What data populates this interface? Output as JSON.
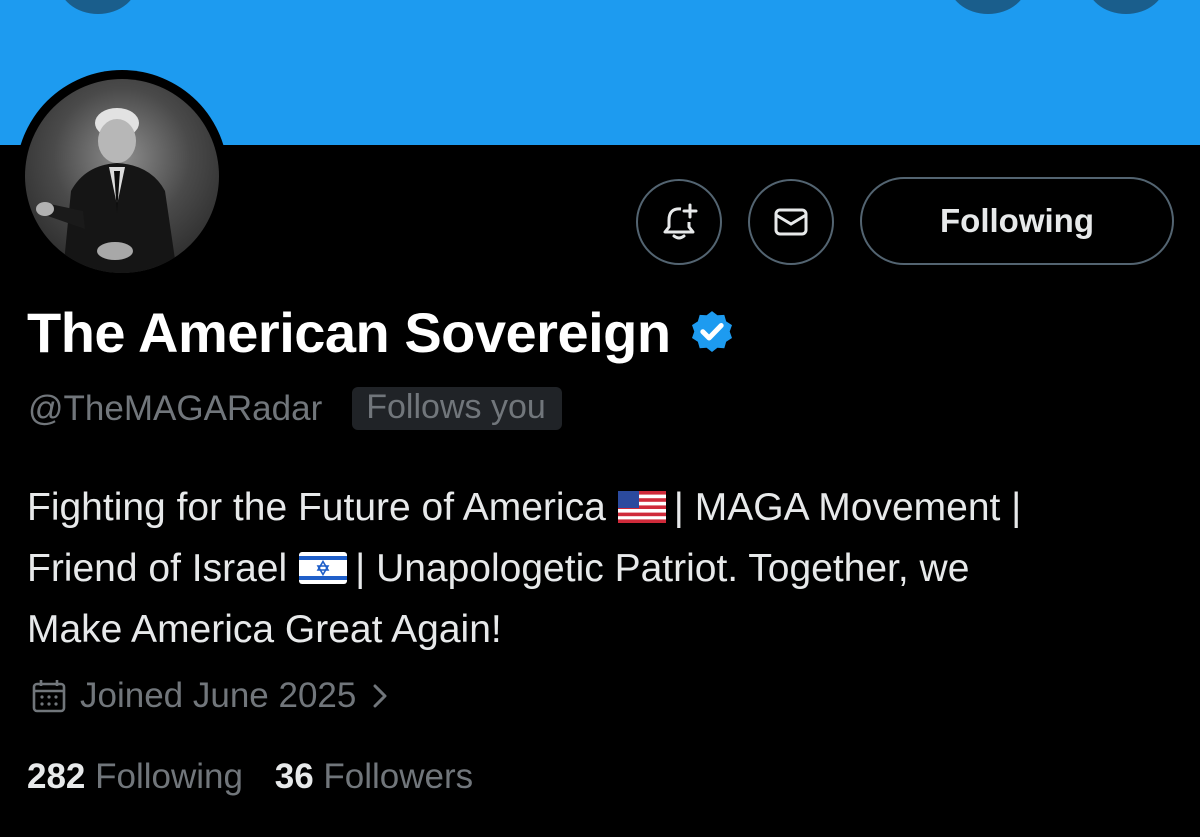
{
  "profile": {
    "display_name": "The American Sovereign",
    "handle": "@TheMAGARadar",
    "follows_you_label": "Follows you",
    "verified": true,
    "bio_line1": "Fighting for the Future of America",
    "bio_line1_rest": "| MAGA Movement |",
    "bio_line2": "Friend of Israel",
    "bio_line2_rest": "| Unapologetic Patriot. Together, we",
    "bio_line3": "Make America Great Again!",
    "joined": "Joined June 2025",
    "following_count": "282",
    "following_label": "Following",
    "followers_count": "36",
    "followers_label": "Followers"
  },
  "actions": {
    "follow_state_label": "Following",
    "notify_icon": "bell-plus-icon",
    "message_icon": "envelope-icon"
  },
  "colors": {
    "banner": "#1d9bf0",
    "verified": "#1d9bf0",
    "secondary_text": "#71767b"
  }
}
